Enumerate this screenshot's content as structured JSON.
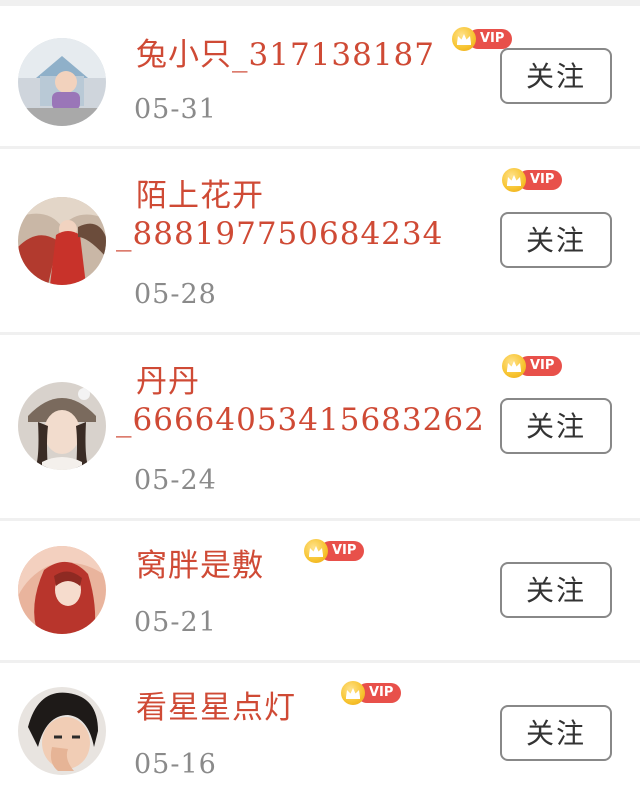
{
  "follow_list": {
    "items": [
      {
        "name_line1": "兔小只_317138187",
        "name_line2": "",
        "date": "05-31",
        "vip_label": "VIP",
        "follow_label": "关注"
      },
      {
        "name_line1": "陌上花开",
        "name_line2": "_888197750684234",
        "date": "05-28",
        "vip_label": "VIP",
        "follow_label": "关注"
      },
      {
        "name_line1": "丹丹",
        "name_line2": "_66664053415683262",
        "date": "05-24",
        "vip_label": "VIP",
        "follow_label": "关注"
      },
      {
        "name_line1": "窝胖是敷",
        "name_line2": "",
        "date": "05-21",
        "vip_label": "VIP",
        "follow_label": "关注"
      },
      {
        "name_line1": "看星星点灯",
        "name_line2": "",
        "date": "05-16",
        "vip_label": "VIP",
        "follow_label": "关注"
      }
    ]
  },
  "colors": {
    "name": "#cf4a35",
    "date": "#8a8a8a",
    "vip_badge": "#e8504a",
    "crown": "#f7c32e",
    "button_border": "#888888",
    "divider": "#f0f0f0"
  },
  "icons": {
    "vip": "crown-icon"
  }
}
